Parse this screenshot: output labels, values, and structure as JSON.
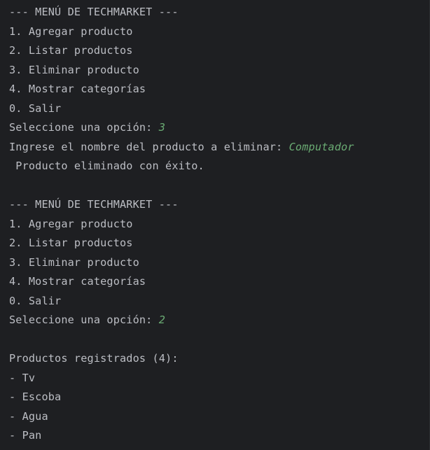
{
  "colors": {
    "background": "#1e1f22",
    "output_text": "#bcbec4",
    "user_input": "#6aab73"
  },
  "console": {
    "lines": [
      {
        "text": "--- MENÚ DE TECHMARKET ---",
        "input": ""
      },
      {
        "text": "1. Agregar producto",
        "input": ""
      },
      {
        "text": "2. Listar productos",
        "input": ""
      },
      {
        "text": "3. Eliminar producto",
        "input": ""
      },
      {
        "text": "4. Mostrar categorías",
        "input": ""
      },
      {
        "text": "0. Salir",
        "input": ""
      },
      {
        "text": "Seleccione una opción: ",
        "input": "3"
      },
      {
        "text": "Ingrese el nombre del producto a eliminar: ",
        "input": "Computador"
      },
      {
        "text": " Producto eliminado con éxito.",
        "input": ""
      },
      {
        "text": "",
        "input": ""
      },
      {
        "text": "--- MENÚ DE TECHMARKET ---",
        "input": ""
      },
      {
        "text": "1. Agregar producto",
        "input": ""
      },
      {
        "text": "2. Listar productos",
        "input": ""
      },
      {
        "text": "3. Eliminar producto",
        "input": ""
      },
      {
        "text": "4. Mostrar categorías",
        "input": ""
      },
      {
        "text": "0. Salir",
        "input": ""
      },
      {
        "text": "Seleccione una opción: ",
        "input": "2"
      },
      {
        "text": "",
        "input": ""
      },
      {
        "text": "Productos registrados (4):",
        "input": ""
      },
      {
        "text": "- Tv",
        "input": ""
      },
      {
        "text": "- Escoba",
        "input": ""
      },
      {
        "text": "- Agua",
        "input": ""
      },
      {
        "text": "- Pan",
        "input": ""
      }
    ]
  }
}
